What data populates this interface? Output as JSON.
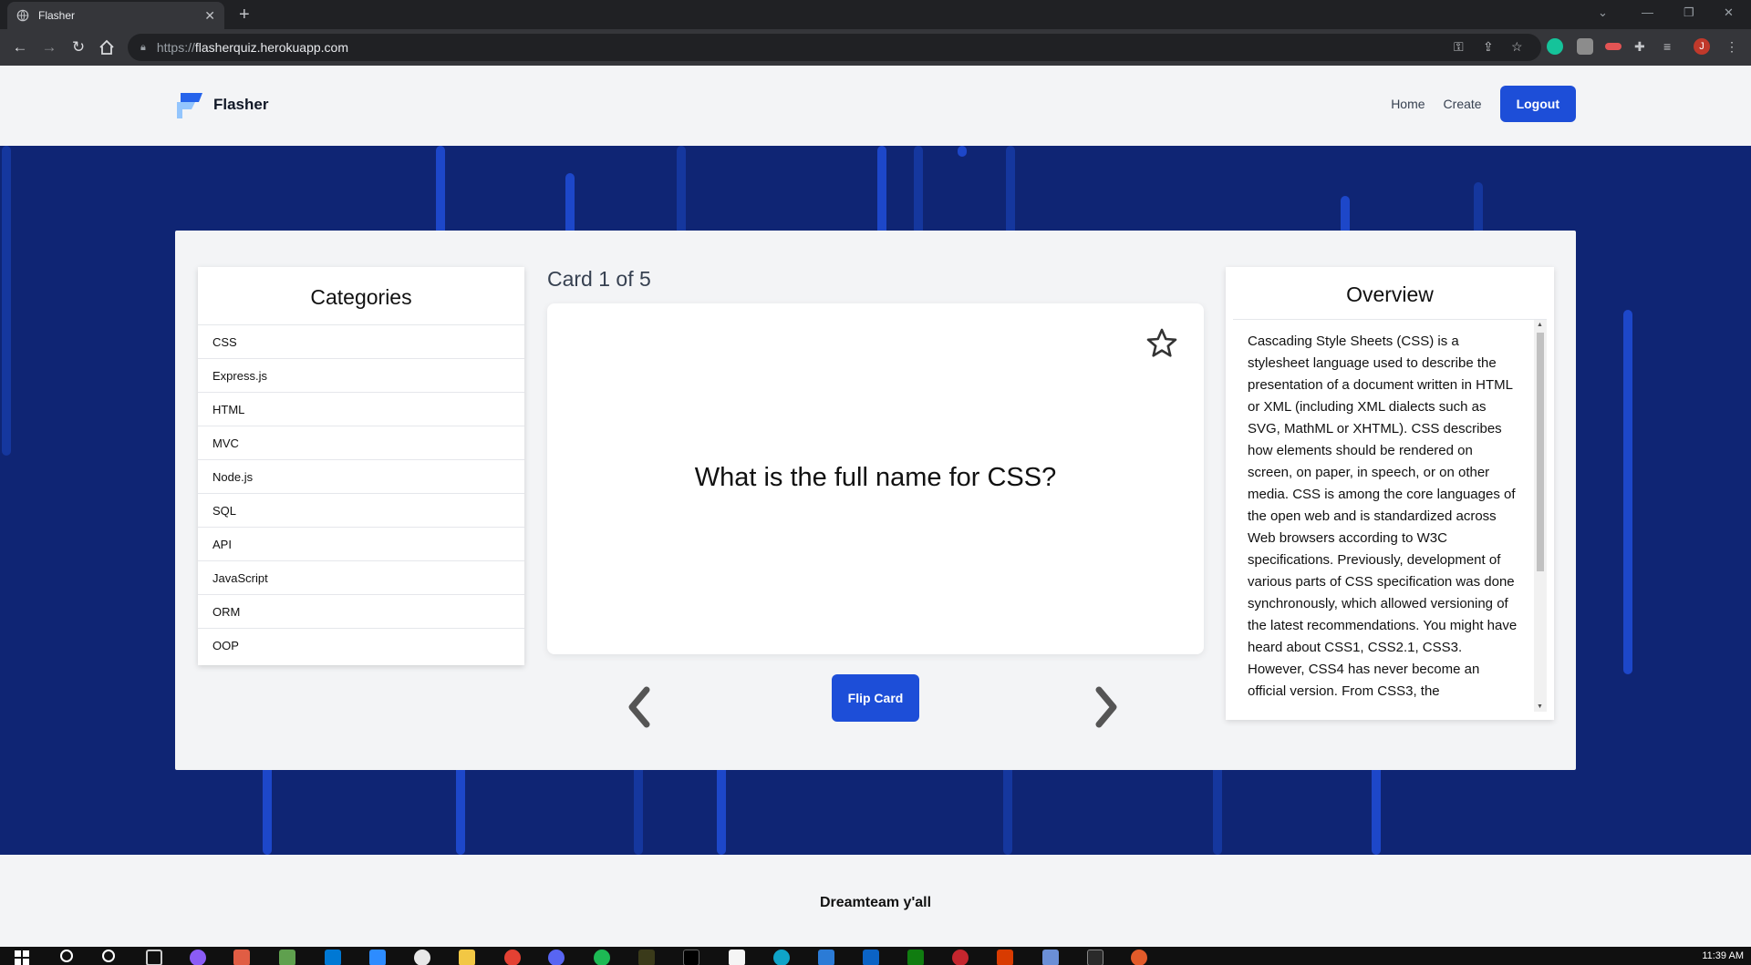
{
  "browser": {
    "tab_title": "Flasher",
    "tab_close": "✕",
    "new_tab": "+",
    "url_scheme": "https://",
    "url_host": "flasherquiz.herokuapp.com",
    "profile_initial": "J"
  },
  "header": {
    "brand": "Flasher",
    "nav": {
      "home": "Home",
      "create": "Create",
      "logout": "Logout"
    }
  },
  "categories": {
    "title": "Categories",
    "items": [
      "CSS",
      "Express.js",
      "HTML",
      "MVC",
      "Node.js",
      "SQL",
      "API",
      "JavaScript",
      "ORM",
      "OOP"
    ]
  },
  "card": {
    "counter": "Card 1 of 5",
    "question": "What is the full name for CSS?",
    "flip_label": "Flip Card"
  },
  "overview": {
    "title": "Overview",
    "text": "Cascading Style Sheets (CSS) is a stylesheet language used to describe the presentation of a document written in HTML or XML (including XML dialects such as SVG, MathML or XHTML). CSS describes how elements should be rendered on screen, on paper, in speech, or on other media. CSS is among the core languages of the open web and is standardized across Web browsers according to W3C specifications. Previously, development of various parts of CSS specification was done synchronously, which allowed versioning of the latest recommendations. You might have heard about CSS1, CSS2.1, CSS3. However, CSS4 has never become an official version. From CSS3, the"
  },
  "footer": {
    "text": "Dreamteam y'all"
  },
  "taskbar": {
    "clock": "11:39 AM"
  },
  "colors": {
    "accent": "#1d4ed8",
    "hero_bg": "#0f2574"
  }
}
